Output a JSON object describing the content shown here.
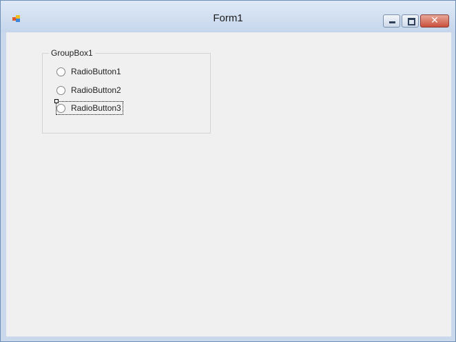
{
  "window": {
    "title": "Form1",
    "icon": "winforms-app-icon",
    "buttons": {
      "minimize": "minimize-icon",
      "maximize": "maximize-icon",
      "close": "close-icon",
      "close_glyph": "✕"
    }
  },
  "groupbox": {
    "label": "GroupBox1",
    "radios": [
      {
        "label": "RadioButton1",
        "checked": false
      },
      {
        "label": "RadioButton2",
        "checked": false
      },
      {
        "label": "RadioButton3",
        "checked": false,
        "focused": true
      }
    ]
  },
  "colors": {
    "titlebar": "#c5d6ec",
    "client": "#f0f0f0",
    "close_button": "#c9503c"
  }
}
